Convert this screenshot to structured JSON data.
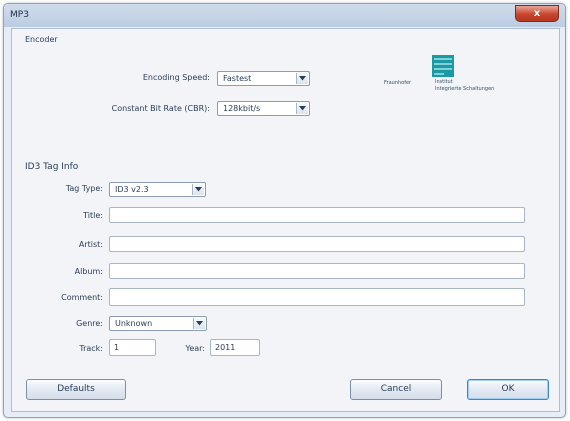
{
  "window": {
    "title": "MP3",
    "close_glyph": "x"
  },
  "encoder": {
    "group_label": "Encoder",
    "speed_label": "Encoding Speed:",
    "speed_value": "Fastest",
    "bitrate_label": "Constant Bit Rate (CBR):",
    "bitrate_value": "128kbit/s"
  },
  "logo": {
    "icon": "fraunhofer-institute-logo",
    "brand": "Fraunhofer",
    "line1": "Institut",
    "line2": "Integrierte Schaltungen",
    "colors": {
      "teal": "#1b9aa5"
    }
  },
  "id3": {
    "group_label": "ID3 Tag Info",
    "tag_type_label": "Tag Type:",
    "tag_type_value": "ID3 v2.3",
    "title_label": "Title:",
    "title_value": "",
    "artist_label": "Artist:",
    "artist_value": "",
    "album_label": "Album:",
    "album_value": "",
    "comment_label": "Comment:",
    "comment_value": "",
    "genre_label": "Genre:",
    "genre_value": "Unknown",
    "track_label": "Track:",
    "track_value": "1",
    "year_label": "Year:",
    "year_value": "2011"
  },
  "buttons": {
    "defaults": "Defaults",
    "cancel": "Cancel",
    "ok": "OK"
  },
  "colors": {
    "window_bg": "#e6edf6",
    "client_bg": "#f2f4f8",
    "close_red": "#c8452f",
    "ok_focus": "#3a86c8"
  }
}
